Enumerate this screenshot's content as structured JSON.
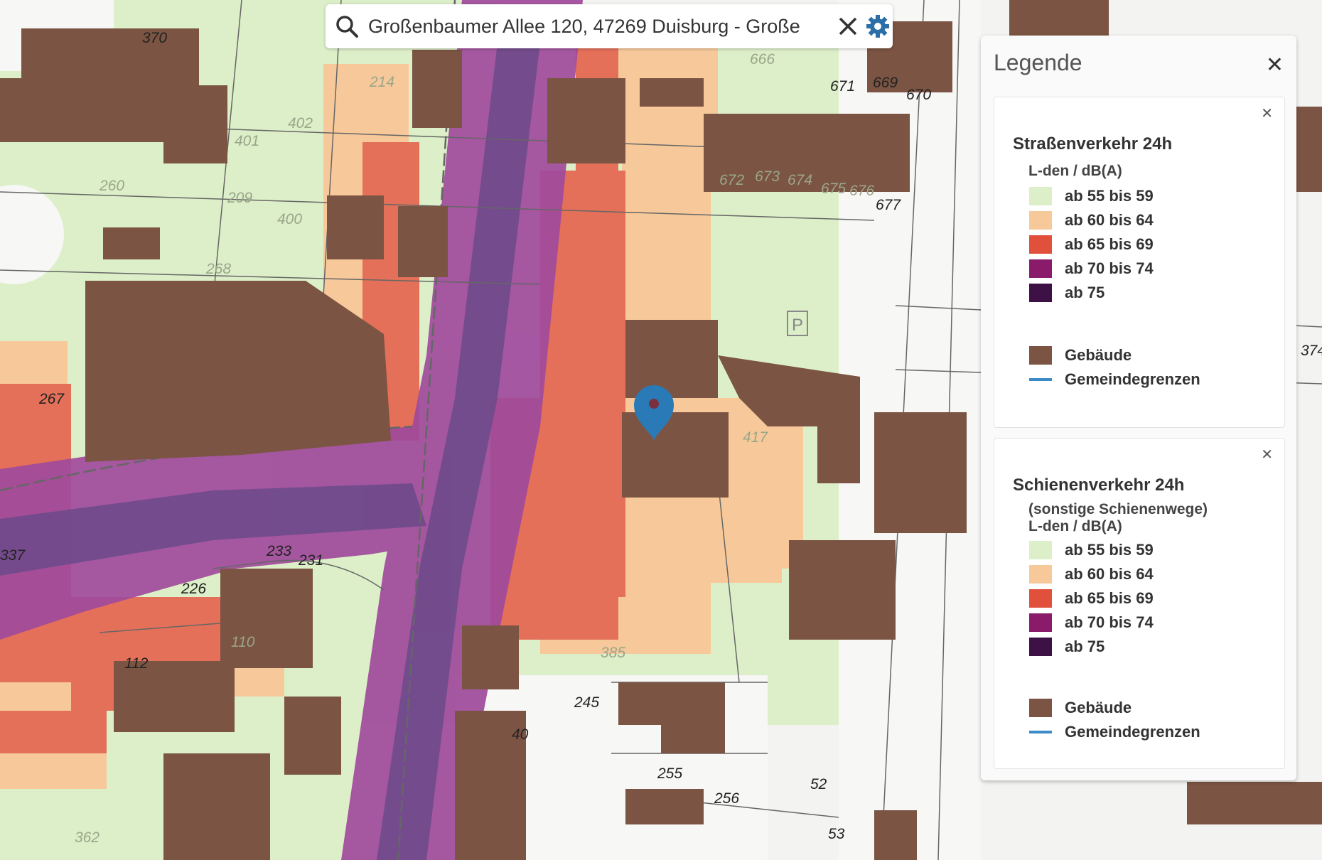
{
  "search": {
    "value": "Großenbaumer Allee 120, 47269 Duisburg - Große",
    "search_icon": "search-icon",
    "clear_icon": "close-icon",
    "settings_icon": "gear-icon"
  },
  "legend": {
    "title": "Legende",
    "close_icon": "close-icon",
    "sections": [
      {
        "title": "Straßenverkehr 24h",
        "subtitles": [
          "L-den / dB(A)"
        ],
        "levels": [
          {
            "label": "ab 55 bis 59",
            "color": "#dcefc8"
          },
          {
            "label": "ab 60 bis 64",
            "color": "#f7c99a"
          },
          {
            "label": "ab 65 bis 69",
            "color": "#e0503b"
          },
          {
            "label": "ab 70 bis 74",
            "color": "#8a1a6a"
          },
          {
            "label": "ab 75",
            "color": "#3d1046"
          }
        ],
        "extras": [
          {
            "label": "Gebäude",
            "color": "#7b5443",
            "kind": "box"
          },
          {
            "label": "Gemeindegrenzen",
            "color": "#3b8bc9",
            "kind": "line"
          }
        ]
      },
      {
        "title": "Schienenverkehr 24h",
        "subtitles": [
          "(sonstige Schienenwege)",
          "L-den / dB(A)"
        ],
        "levels": [
          {
            "label": "ab 55 bis 59",
            "color": "#dcefc8"
          },
          {
            "label": "ab 60 bis 64",
            "color": "#f7c99a"
          },
          {
            "label": "ab 65 bis 69",
            "color": "#e0503b"
          },
          {
            "label": "ab 70 bis 74",
            "color": "#8a1a6a"
          },
          {
            "label": "ab 75",
            "color": "#3d1046"
          }
        ],
        "extras": [
          {
            "label": "Gebäude",
            "color": "#7b5443",
            "kind": "box"
          },
          {
            "label": "Gemeindegrenzen",
            "color": "#3b8bc9",
            "kind": "line"
          }
        ]
      }
    ]
  },
  "map": {
    "marker_icon": "map-pin-icon",
    "marker_color": "#2b7ab8",
    "parcel_numbers": [
      "370",
      "214",
      "402",
      "401",
      "260",
      "209",
      "400",
      "268",
      "267",
      "337",
      "233",
      "231",
      "226",
      "112",
      "110",
      "362",
      "245",
      "40",
      "255",
      "256",
      "52",
      "53",
      "385",
      "417",
      "666",
      "669",
      "670",
      "671",
      "672",
      "673",
      "674",
      "675",
      "676",
      "677",
      "374"
    ]
  }
}
